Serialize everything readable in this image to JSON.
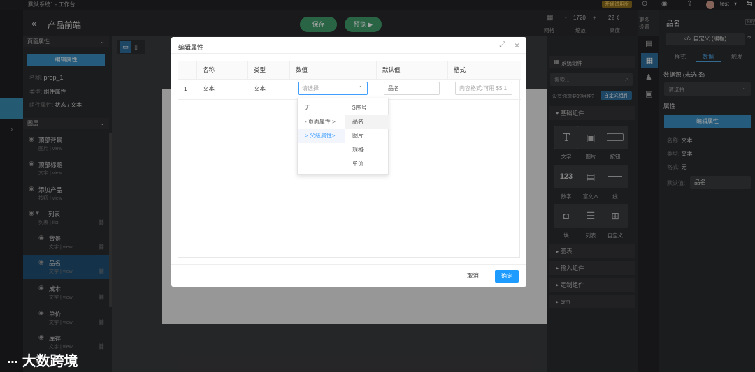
{
  "app": {
    "window_title": "默认系统1 - 工作台",
    "page_title": "产品前端",
    "save_label": "保存",
    "preview_label": "预览",
    "upgrade_badge": "开通试用版",
    "user": "test"
  },
  "toolbar": {
    "grid_label": "网格",
    "zoom_value": "1720",
    "zoom_label": "缩放",
    "height_value": "22",
    "height_label": "高度",
    "more_label": "更多设置"
  },
  "left_panel": {
    "page_props_title": "页面属性",
    "edit_props_btn": "编辑属性",
    "name_label": "名称:",
    "name_value": "prop_1",
    "type_label": "类型:",
    "type_value": "组件属性",
    "comp_prop_label": "组件属性:",
    "comp_prop_value": "状态 / 文本",
    "layers_title": "图层",
    "layers": [
      {
        "name": "顶部背景",
        "sub": "图片 | view"
      },
      {
        "name": "顶部标题",
        "sub": "文字 | view"
      },
      {
        "name": "添加产品",
        "sub": "按钮 | view"
      },
      {
        "name": "列表",
        "sub": "列表 | list"
      },
      {
        "name": "背景",
        "sub": "文字 | view"
      },
      {
        "name": "品名",
        "sub": "文字 | view"
      },
      {
        "name": "成本",
        "sub": "文字 | view"
      },
      {
        "name": "单价",
        "sub": "文字 | view"
      },
      {
        "name": "库存",
        "sub": "文字 | view"
      }
    ]
  },
  "components": {
    "title": "系统组件",
    "search_placeholder": "搜索...",
    "custom_hint": "没有你想要的组件?",
    "custom_btn": "自定义组件",
    "basic_title": "基础组件",
    "tiles": [
      "文字",
      "图片",
      "按钮",
      "数字",
      "富文本",
      "线",
      "块",
      "列表",
      "自定义"
    ],
    "sections": [
      "图表",
      "输入组件",
      "定制组件",
      "crm"
    ]
  },
  "prop_panel": {
    "title": "品名",
    "custom_code_btn": "</> 自定义 (编程)",
    "key_label": "key",
    "tabs": [
      "样式",
      "数据",
      "触发"
    ],
    "datasource_label": "数据源 (未选择)",
    "datasource_placeholder": "请选择",
    "attrs_label": "属性",
    "edit_attrs_btn": "编辑属性",
    "name_label": "名称:",
    "name_value": "文本",
    "type_label": "类型:",
    "type_value": "文本",
    "format_label": "格式:",
    "format_value": "无",
    "default_label": "默认值:",
    "default_value": "品名"
  },
  "modal": {
    "title": "编辑属性",
    "columns": [
      "名称",
      "类型",
      "数值",
      "默认值",
      "格式"
    ],
    "row": {
      "index": "1",
      "name": "文本",
      "type": "文本",
      "value_placeholder": "请选择",
      "default_value": "品名",
      "format_placeholder": "内容格式:可用 $$ 1"
    },
    "cascader_col1": [
      "无",
      "- 页面属性 >",
      "> 父级属性>"
    ],
    "cascader_col2": [
      "$序号",
      "品名",
      "图片",
      "规格",
      "单价"
    ],
    "cancel_label": "取消",
    "ok_label": "确定"
  },
  "watermark": "大数跨境"
}
